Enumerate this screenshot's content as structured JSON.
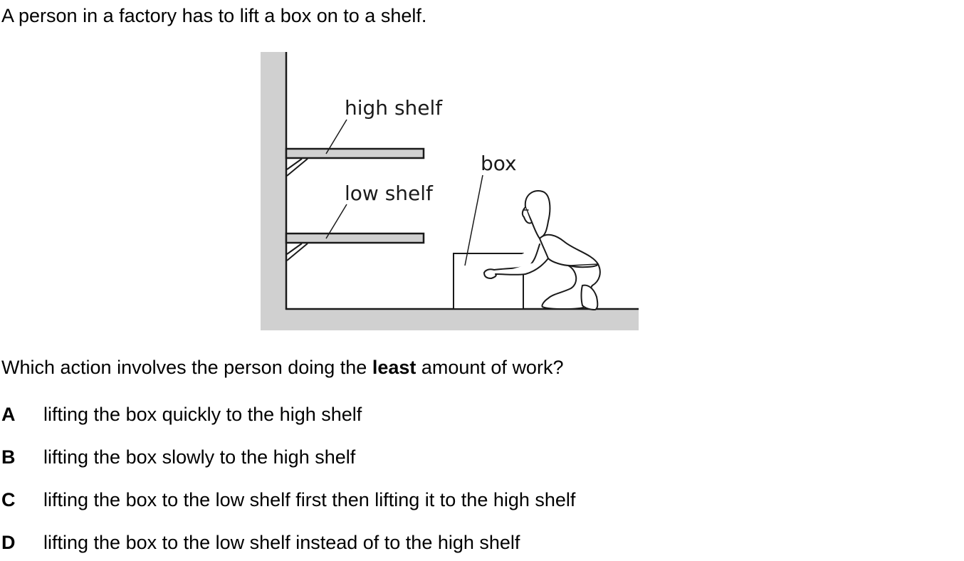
{
  "intro_text": "A person in a factory has to lift a box on to a shelf.",
  "figure": {
    "labels": {
      "high_shelf": "high shelf",
      "low_shelf": "low shelf",
      "box": "box"
    },
    "colors": {
      "wall_fill": "#d0d0d0",
      "line": "#1a1a1a"
    }
  },
  "question": {
    "before": "Which action involves the person doing the ",
    "emphasis": "least",
    "after": " amount of work?"
  },
  "options": [
    {
      "letter": "A",
      "text": "lifting the box quickly to the high shelf"
    },
    {
      "letter": "B",
      "text": "lifting the box slowly to the high shelf"
    },
    {
      "letter": "C",
      "text": "lifting the box to the low shelf first then lifting it to the high shelf"
    },
    {
      "letter": "D",
      "text": "lifting the box to the low shelf instead of to the high shelf"
    }
  ]
}
